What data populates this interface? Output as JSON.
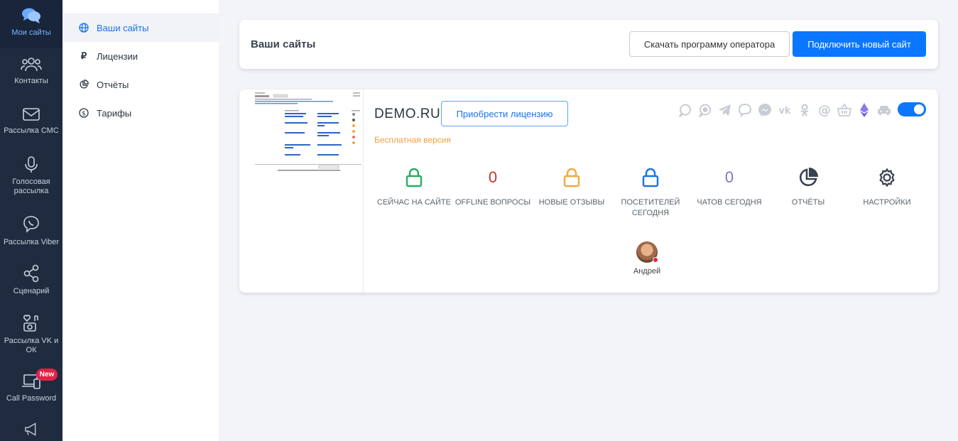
{
  "leftnav": {
    "items": [
      {
        "label": "Мои сайты",
        "icon": "chat-bubbles-icon",
        "active": true
      },
      {
        "label": "Контакты",
        "icon": "users-icon"
      },
      {
        "label": "Рассылка СМС",
        "icon": "envelope-icon"
      },
      {
        "label": "Голосовая рассылка",
        "icon": "microphone-icon"
      },
      {
        "label": "Рассылка Viber",
        "icon": "viber-icon"
      },
      {
        "label": "Сценарий",
        "icon": "share-nodes-icon"
      },
      {
        "label": "Рассылка VK и ОК",
        "icon": "camera-heart-icon"
      },
      {
        "label": "Call Password",
        "icon": "laptop-phone-icon"
      },
      {
        "label": "",
        "icon": "megaphone-icon"
      }
    ],
    "new_badge": "New"
  },
  "subnav": {
    "items": [
      {
        "label": "Ваши сайты",
        "icon": "globe-icon",
        "active": true
      },
      {
        "label": "Лицензии",
        "icon": "ruble-icon"
      },
      {
        "label": "Отчёты",
        "icon": "pie-chart-icon"
      },
      {
        "label": "Тарифы",
        "icon": "dollar-coin-icon"
      }
    ]
  },
  "header": {
    "title": "Ваши сайты",
    "download_label": "Скачать программу оператора",
    "connect_label": "Подключить новый сайт"
  },
  "site": {
    "domain": "DEMO.RU",
    "license_button": "Приобрести лицензию",
    "version": "Бесплатная версия",
    "enabled": true,
    "channels": [
      "whatsapp-icon",
      "whatsapp-business-icon",
      "telegram-icon",
      "viber-icon",
      "messenger-icon",
      "vk-icon",
      "ok-icon",
      "email-icon",
      "basket-icon",
      "ethereum-icon",
      "car-icon"
    ],
    "stats": [
      {
        "label": "Сейчас на сайте",
        "icon": "lock-green-icon",
        "color": "#27ae60"
      },
      {
        "label": "Offline вопросы",
        "value": "0",
        "color": "#c0392b"
      },
      {
        "label": "Новые отзывы",
        "icon": "lock-orange-icon",
        "color": "#f0a940"
      },
      {
        "label": "Посетителей сегодня",
        "icon": "lock-blue-icon",
        "color": "#1a73e8"
      },
      {
        "label": "Чатов сегодня",
        "value": "0",
        "color": "#7a78c8"
      },
      {
        "label": "Отчёты",
        "icon": "pie-chart-icon",
        "color": "#3a4250"
      },
      {
        "label": "Настройки",
        "icon": "gear-icon",
        "color": "#3a4250"
      }
    ],
    "operator": {
      "name": "Андрей",
      "status_color": "#e32246"
    }
  },
  "colors": {
    "accent": "#0b76ff",
    "nav_bg": "#1f2c3f",
    "free_version": "#f0a040"
  }
}
